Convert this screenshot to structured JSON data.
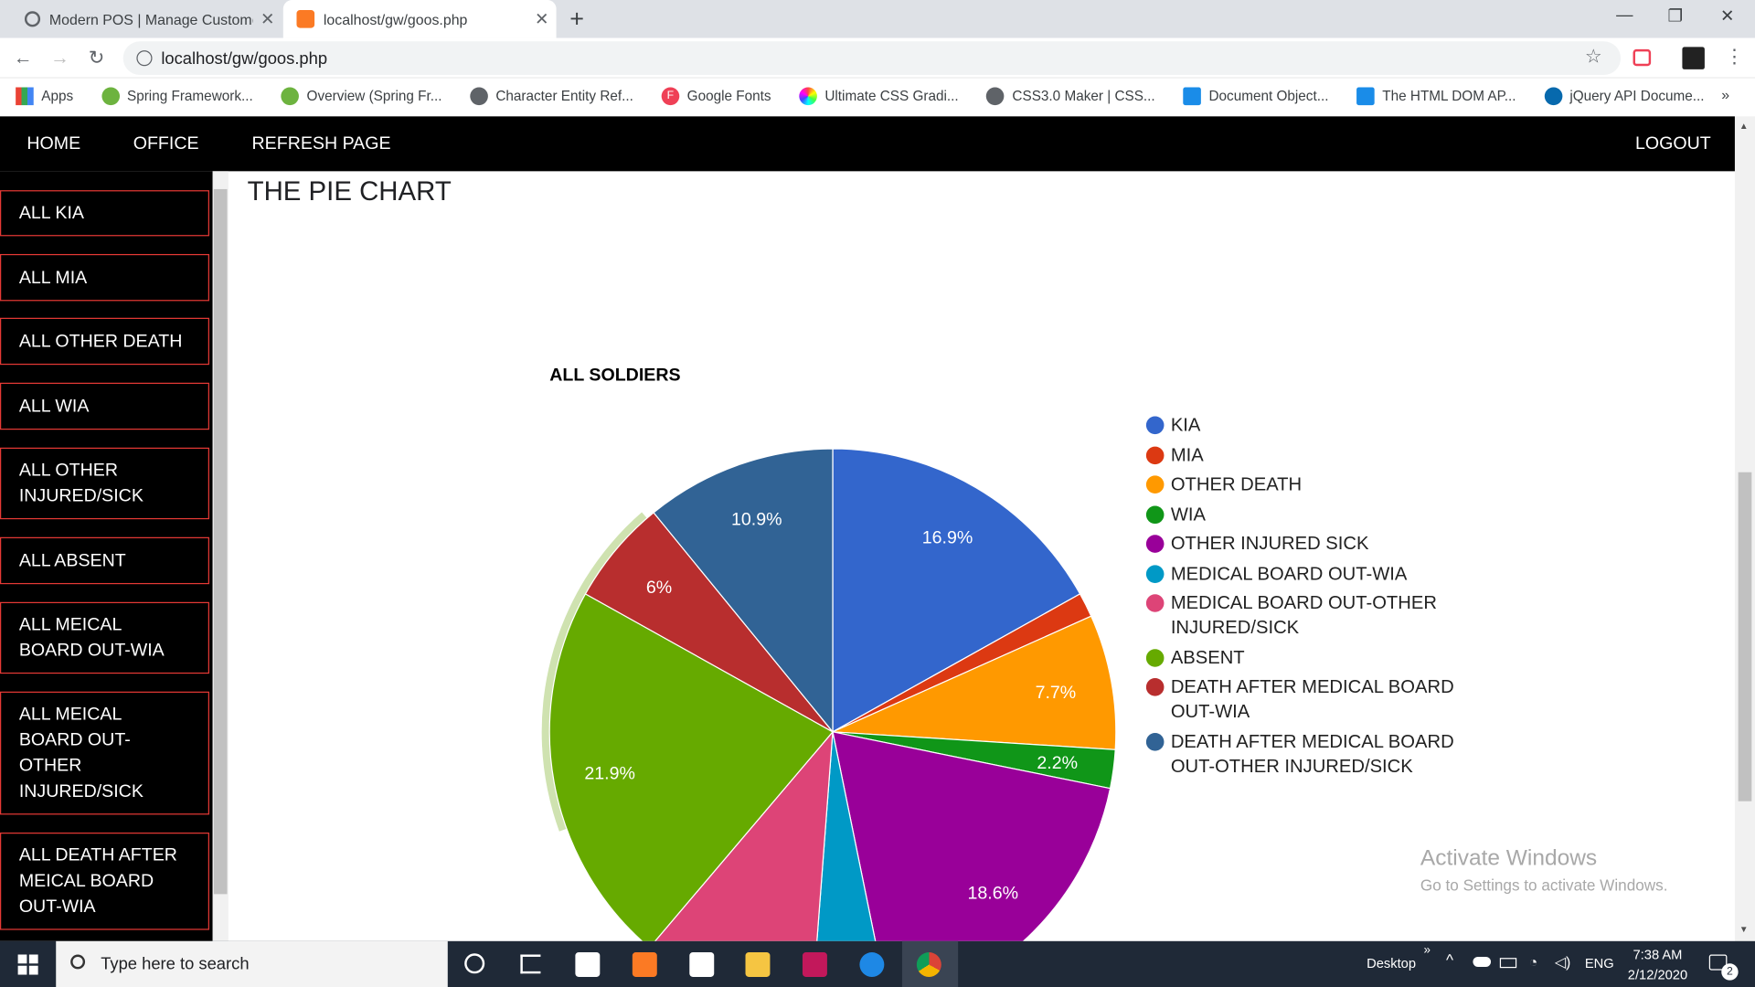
{
  "browser": {
    "tabs": [
      {
        "title": "Modern POS | Manage Customer",
        "active": false
      },
      {
        "title": "localhost/gw/goos.php",
        "active": true
      }
    ],
    "url": "localhost/gw/goos.php",
    "bookmarks": [
      "Apps",
      "Spring Framework...",
      "Overview (Spring Fr...",
      "Character Entity Ref...",
      "Google Fonts",
      "Ultimate CSS Gradi...",
      "CSS3.0 Maker | CSS...",
      "Document Object...",
      "The HTML DOM AP...",
      "jQuery API Docume..."
    ],
    "bookmarks_more": "»"
  },
  "nav": {
    "home": "HOME",
    "office": "OFFICE",
    "refresh": "REFRESH PAGE",
    "logout": "LOGOUT"
  },
  "sidebar": {
    "items": [
      {
        "label": "ALL KIA"
      },
      {
        "label": "ALL MIA"
      },
      {
        "label": "ALL OTHER DEATH"
      },
      {
        "label": "ALL WIA"
      },
      {
        "label": "ALL OTHER INJURED/SICK"
      },
      {
        "label": "ALL ABSENT"
      },
      {
        "label": "ALL MEICAL BOARD OUT-WIA"
      },
      {
        "label": "ALL MEICAL BOARD OUT-OTHER INJURED/SICK"
      },
      {
        "label": "ALL DEATH AFTER MEICAL BOARD OUT-WIA"
      }
    ]
  },
  "page": {
    "title": "THE PIE CHART"
  },
  "chart_data": {
    "type": "pie",
    "title": "ALL SOLDIERS",
    "legend_position": "right",
    "slices": [
      {
        "label": "KIA",
        "value": 16.9,
        "color": "#3366cc",
        "data_label": "16.9%"
      },
      {
        "label": "MIA",
        "value": 1.4,
        "color": "#dc3912",
        "data_label": ""
      },
      {
        "label": "OTHER DEATH",
        "value": 7.7,
        "color": "#ff9900",
        "data_label": "7.7%"
      },
      {
        "label": "WIA",
        "value": 2.2,
        "color": "#109618",
        "data_label": "2.2%"
      },
      {
        "label": "OTHER INJURED SICK",
        "value": 18.6,
        "color": "#990099",
        "data_label": "18.6%"
      },
      {
        "label": "MEDICAL BOARD OUT-WIA",
        "value": 4.4,
        "color": "#0099c6",
        "data_label": ""
      },
      {
        "label": "MEDICAL BOARD OUT-OTHER INJURED/SICK",
        "value": 10.0,
        "color": "#dd4477",
        "data_label": ""
      },
      {
        "label": "ABSENT",
        "value": 21.9,
        "color": "#66aa00",
        "data_label": "21.9%"
      },
      {
        "label": "DEATH AFTER MEDICAL BOARD OUT-WIA",
        "value": 6.0,
        "color": "#b82e2e",
        "data_label": "6%"
      },
      {
        "label": "DEATH AFTER MEDICAL BOARD OUT-OTHER INJURED/SICK",
        "value": 10.9,
        "color": "#316395",
        "data_label": "10.9%"
      }
    ]
  },
  "watermark": {
    "line1": "Activate Windows",
    "line2": "Go to Settings to activate Windows."
  },
  "taskbar": {
    "search_placeholder": "Type here to search",
    "desktop_label": "Desktop",
    "lang": "ENG",
    "time": "7:38 AM",
    "date": "2/12/2020",
    "notifications": "2"
  }
}
